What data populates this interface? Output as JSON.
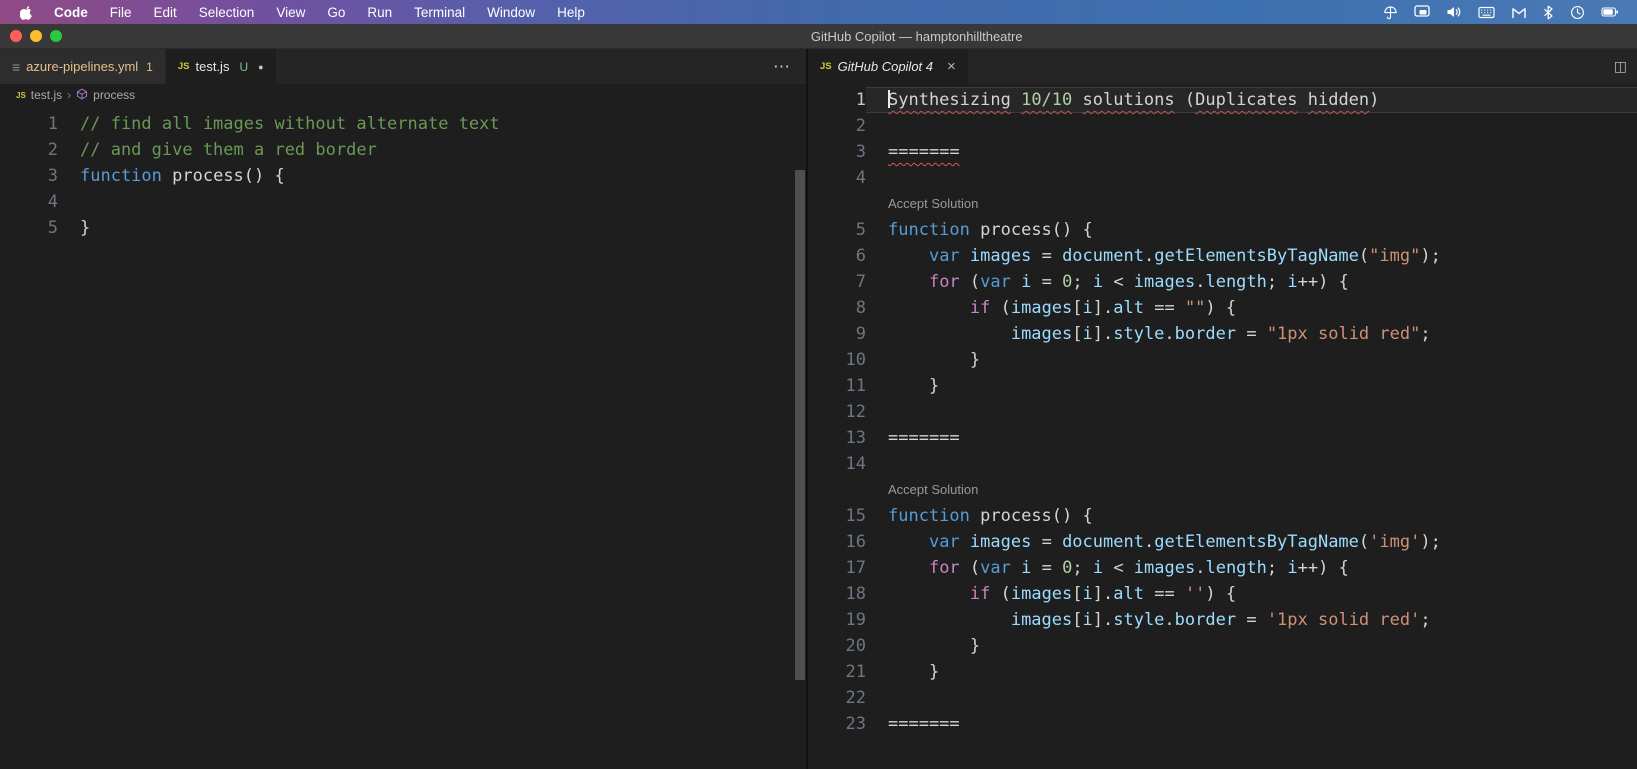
{
  "colors": {
    "editor_bg": "#1e1e1e",
    "tabbar_bg": "#252526",
    "tab_inactive_bg": "#2d2d2d",
    "tab_active_bg": "#1e1e1e",
    "titlebar_bg": "#383838",
    "comment": "#6a9955",
    "keyword": "#569cd6",
    "control_keyword": "#c586c0",
    "variable": "#9cdcfe",
    "string": "#ce9178",
    "number": "#b5cea8",
    "default_text": "#d4d4d4",
    "line_number": "#6e7681",
    "modified_label": "#e2c08d",
    "untracked_badge": "#73c991",
    "codelens": "#999999",
    "squiggle_word": "#b4554e",
    "squiggle_error": "#e0534e"
  },
  "menubar": {
    "apple_icon": "apple-logo-icon",
    "items": [
      "Code",
      "File",
      "Edit",
      "Selection",
      "View",
      "Go",
      "Run",
      "Terminal",
      "Window",
      "Help"
    ],
    "status_icons": [
      "umbrella-icon",
      "display-icon",
      "volume-icon",
      "keyboard-icon",
      "gmail-icon",
      "bluetooth-icon",
      "clock-icon",
      "battery-icon"
    ]
  },
  "titlebar": {
    "title": "GitHub Copilot — hamptonhilltheatre"
  },
  "left_pane": {
    "tabs": [
      {
        "icon": "yaml-file-icon",
        "label": "azure-pipelines.yml",
        "badge": "1"
      },
      {
        "icon": "js-file-icon",
        "icon_text": "JS",
        "label": "test.js",
        "git_status": "U",
        "dirty_dot": "●"
      }
    ],
    "more_actions_label": "⋯",
    "breadcrumb": {
      "file_icon_text": "JS",
      "file": "test.js",
      "separator": "›",
      "symbol": "process"
    },
    "rows": [
      {
        "num": "1",
        "tokens": [
          [
            "// find all images without alternate text",
            "cm"
          ]
        ]
      },
      {
        "num": "2",
        "tokens": [
          [
            "// and give them a red border",
            "cm"
          ]
        ]
      },
      {
        "num": "3",
        "tokens": [
          [
            "function",
            "kw"
          ],
          [
            " ",
            "d"
          ],
          [
            "process",
            "fn"
          ],
          [
            "() {",
            "d"
          ]
        ]
      },
      {
        "num": "4",
        "tokens": []
      },
      {
        "num": "5",
        "tokens": [
          [
            "}",
            "d"
          ]
        ]
      }
    ]
  },
  "right_pane": {
    "tab": {
      "icon": "js-file-icon",
      "icon_text": "JS",
      "label": "GitHub Copilot 4",
      "close_label": "×"
    },
    "split_icon_label": "◫",
    "accept_label": "Accept Solution",
    "rows": [
      {
        "num": "1",
        "cur": true,
        "cursor": true,
        "tokens": [
          [
            "Synthesizing",
            "d",
            "sq"
          ],
          [
            " ",
            "d"
          ],
          [
            "10/10",
            "n",
            "sq"
          ],
          [
            " ",
            "d"
          ],
          [
            "solutions",
            "d",
            "sq"
          ],
          [
            " (",
            "d"
          ],
          [
            "Duplicates",
            "d",
            "sq"
          ],
          [
            " ",
            "d"
          ],
          [
            "hidden",
            "d",
            "sq"
          ],
          [
            ")",
            "d"
          ]
        ]
      },
      {
        "num": "2",
        "tokens": []
      },
      {
        "num": "3",
        "tokens": [
          [
            "=======",
            "d",
            "sqr"
          ]
        ]
      },
      {
        "num": "4",
        "tokens": []
      },
      {
        "lens": true
      },
      {
        "num": "5",
        "tokens": [
          [
            "function",
            "kw"
          ],
          [
            " ",
            "d"
          ],
          [
            "process",
            "fn"
          ],
          [
            "() {",
            "d"
          ]
        ]
      },
      {
        "num": "6",
        "tokens": [
          [
            "    ",
            "d"
          ],
          [
            "var",
            "kw"
          ],
          [
            " ",
            "d"
          ],
          [
            "images",
            "v"
          ],
          [
            " = ",
            "d"
          ],
          [
            "document",
            "v"
          ],
          [
            ".",
            "d"
          ],
          [
            "getElementsByTagName",
            "v"
          ],
          [
            "(",
            "d"
          ],
          [
            "\"img\"",
            "s"
          ],
          [
            ");",
            "d"
          ]
        ]
      },
      {
        "num": "7",
        "tokens": [
          [
            "    ",
            "d"
          ],
          [
            "for",
            "ct"
          ],
          [
            " (",
            "d"
          ],
          [
            "var",
            "kw"
          ],
          [
            " ",
            "d"
          ],
          [
            "i",
            "v"
          ],
          [
            " = ",
            "d"
          ],
          [
            "0",
            "n"
          ],
          [
            "; ",
            "d"
          ],
          [
            "i",
            "v"
          ],
          [
            " < ",
            "d"
          ],
          [
            "images",
            "v"
          ],
          [
            ".",
            "d"
          ],
          [
            "length",
            "v"
          ],
          [
            "; ",
            "d"
          ],
          [
            "i",
            "v"
          ],
          [
            "++) {",
            "d"
          ]
        ]
      },
      {
        "num": "8",
        "tokens": [
          [
            "        ",
            "d"
          ],
          [
            "if",
            "ct"
          ],
          [
            " (",
            "d"
          ],
          [
            "images",
            "v"
          ],
          [
            "[",
            "d"
          ],
          [
            "i",
            "v"
          ],
          [
            "].",
            "d"
          ],
          [
            "alt",
            "v"
          ],
          [
            " == ",
            "d"
          ],
          [
            "\"\"",
            "s"
          ],
          [
            ") {",
            "d"
          ]
        ]
      },
      {
        "num": "9",
        "tokens": [
          [
            "            ",
            "d"
          ],
          [
            "images",
            "v"
          ],
          [
            "[",
            "d"
          ],
          [
            "i",
            "v"
          ],
          [
            "].",
            "d"
          ],
          [
            "style",
            "v"
          ],
          [
            ".",
            "d"
          ],
          [
            "border",
            "v"
          ],
          [
            " = ",
            "d"
          ],
          [
            "\"1px solid red\"",
            "s"
          ],
          [
            ";",
            "d"
          ]
        ]
      },
      {
        "num": "10",
        "tokens": [
          [
            "        }",
            "d"
          ]
        ]
      },
      {
        "num": "11",
        "tokens": [
          [
            "    }",
            "d"
          ]
        ]
      },
      {
        "num": "12",
        "tokens": []
      },
      {
        "num": "13",
        "tokens": [
          [
            "=======",
            "d"
          ]
        ]
      },
      {
        "num": "14",
        "tokens": []
      },
      {
        "lens": true
      },
      {
        "num": "15",
        "tokens": [
          [
            "function",
            "kw"
          ],
          [
            " ",
            "d"
          ],
          [
            "process",
            "fn"
          ],
          [
            "() {",
            "d"
          ]
        ]
      },
      {
        "num": "16",
        "tokens": [
          [
            "    ",
            "d"
          ],
          [
            "var",
            "kw"
          ],
          [
            " ",
            "d"
          ],
          [
            "images",
            "v"
          ],
          [
            " = ",
            "d"
          ],
          [
            "document",
            "v"
          ],
          [
            ".",
            "d"
          ],
          [
            "getElementsByTagName",
            "v"
          ],
          [
            "(",
            "d"
          ],
          [
            "'img'",
            "s"
          ],
          [
            ");",
            "d"
          ]
        ]
      },
      {
        "num": "17",
        "tokens": [
          [
            "    ",
            "d"
          ],
          [
            "for",
            "ct"
          ],
          [
            " (",
            "d"
          ],
          [
            "var",
            "kw"
          ],
          [
            " ",
            "d"
          ],
          [
            "i",
            "v"
          ],
          [
            " = ",
            "d"
          ],
          [
            "0",
            "n"
          ],
          [
            "; ",
            "d"
          ],
          [
            "i",
            "v"
          ],
          [
            " < ",
            "d"
          ],
          [
            "images",
            "v"
          ],
          [
            ".",
            "d"
          ],
          [
            "length",
            "v"
          ],
          [
            "; ",
            "d"
          ],
          [
            "i",
            "v"
          ],
          [
            "++) {",
            "d"
          ]
        ]
      },
      {
        "num": "18",
        "tokens": [
          [
            "        ",
            "d"
          ],
          [
            "if",
            "ct"
          ],
          [
            " (",
            "d"
          ],
          [
            "images",
            "v"
          ],
          [
            "[",
            "d"
          ],
          [
            "i",
            "v"
          ],
          [
            "].",
            "d"
          ],
          [
            "alt",
            "v"
          ],
          [
            " == ",
            "d"
          ],
          [
            "''",
            "s"
          ],
          [
            ") {",
            "d"
          ]
        ]
      },
      {
        "num": "19",
        "tokens": [
          [
            "            ",
            "d"
          ],
          [
            "images",
            "v"
          ],
          [
            "[",
            "d"
          ],
          [
            "i",
            "v"
          ],
          [
            "].",
            "d"
          ],
          [
            "style",
            "v"
          ],
          [
            ".",
            "d"
          ],
          [
            "border",
            "v"
          ],
          [
            " = ",
            "d"
          ],
          [
            "'1px solid red'",
            "s"
          ],
          [
            ";",
            "d"
          ]
        ]
      },
      {
        "num": "20",
        "tokens": [
          [
            "        }",
            "d"
          ]
        ]
      },
      {
        "num": "21",
        "tokens": [
          [
            "    }",
            "d"
          ]
        ]
      },
      {
        "num": "22",
        "tokens": []
      },
      {
        "num": "23",
        "tokens": [
          [
            "=======",
            "d"
          ]
        ]
      }
    ]
  }
}
